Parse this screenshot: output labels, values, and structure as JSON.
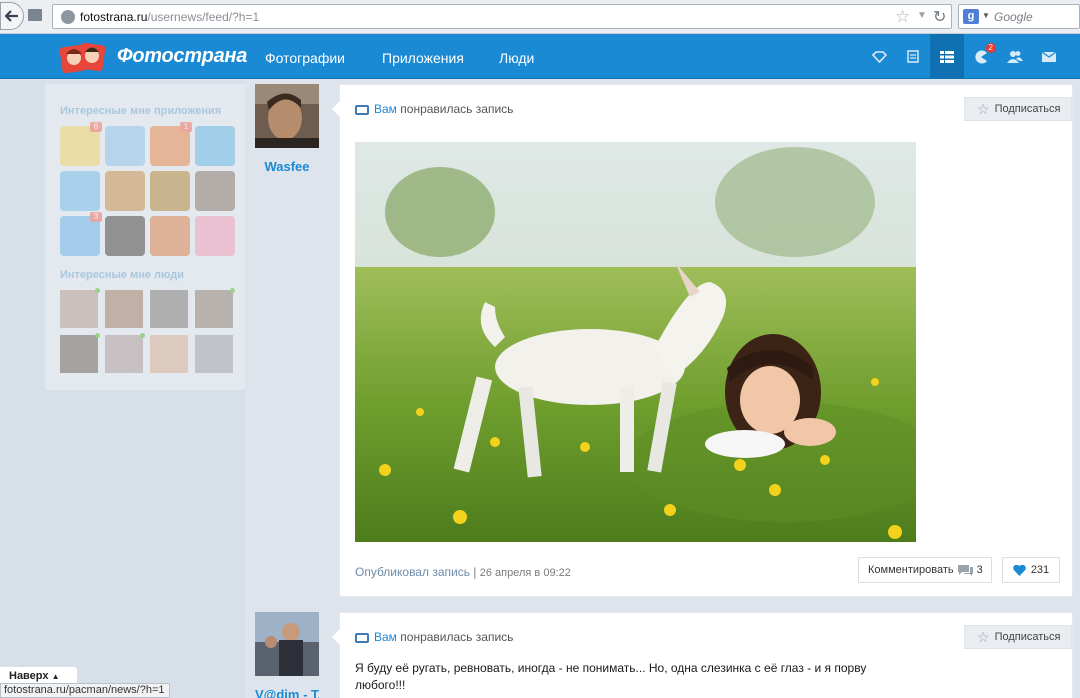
{
  "browser": {
    "url_host": "fotostrana.ru",
    "url_path": "/usernews/feed/?h=1",
    "search_placeholder": "Google"
  },
  "header": {
    "logo_text": "Фотострана",
    "nav": [
      "Фотографии",
      "Приложения",
      "Люди"
    ],
    "notifications_badge": "2"
  },
  "sidebar": {
    "apps_title": "Интересные мне приложения",
    "app_badges": [
      "6",
      "1",
      "3"
    ],
    "people_title": "Интересные мне люди"
  },
  "feed": {
    "posts": [
      {
        "author": "Wasfee",
        "head_you": "Вам",
        "head_text": "понравилась запись",
        "subscribe": "Подписаться",
        "footer_action": "Опубликовал запись",
        "footer_sep": "|",
        "footer_date": "26 апреля в 09:22",
        "comment_label": "Комментировать",
        "comment_count": "3",
        "like_count": "231"
      },
      {
        "author": "V@dim - T...",
        "head_you": "Вам",
        "head_text": "понравилась запись",
        "subscribe": "Подписаться",
        "text": "Я буду её ругать, ревновать, иногда - не понимать... Но, одна слезинка с её глаз - и я порву любого!!!"
      }
    ]
  },
  "overlay": {
    "back_to_top": "Наверх",
    "status_url": "fotostrana.ru/pacman/news/?h=1"
  },
  "colors": {
    "header_blue": "#1a8ad4",
    "link_blue": "#1a8ad4",
    "page_bg": "#dde4ec"
  }
}
